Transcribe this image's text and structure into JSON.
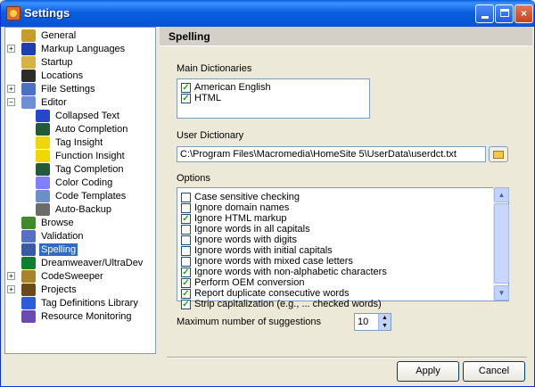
{
  "window": {
    "title": "Settings"
  },
  "tree": {
    "items": [
      {
        "label": "General",
        "icon": "gear-icon",
        "color": "#c79b2c"
      },
      {
        "label": "Markup Languages",
        "icon": "code-brackets-icon",
        "color": "#1d3fb4",
        "expander": "+"
      },
      {
        "label": "Startup",
        "icon": "folder-icon",
        "color": "#d6b34a"
      },
      {
        "label": "Locations",
        "icon": "save-icon",
        "color": "#2c2c2c"
      },
      {
        "label": "File Settings",
        "icon": "file-settings-icon",
        "color": "#4a72c0",
        "expander": "+"
      },
      {
        "label": "Editor",
        "icon": "editor-icon",
        "color": "#6b90d8",
        "expander": "−"
      },
      {
        "label": "Collapsed Text",
        "icon": "collapsed-text-icon",
        "color": "#2448c8"
      },
      {
        "label": "Auto Completion",
        "icon": "glasses-icon",
        "color": "#255a39"
      },
      {
        "label": "Tag Insight",
        "icon": "lightbulb-icon",
        "color": "#f2d600"
      },
      {
        "label": "Function Insight",
        "icon": "lightbulb-icon",
        "color": "#f2d600"
      },
      {
        "label": "Tag Completion",
        "icon": "glasses-icon",
        "color": "#255a39"
      },
      {
        "label": "Color Coding",
        "icon": "color-coding-icon",
        "color": "#8080ff"
      },
      {
        "label": "Code Templates",
        "icon": "templates-icon",
        "color": "#6c8fcc"
      },
      {
        "label": "Auto-Backup",
        "icon": "backup-icon",
        "color": "#6b6b6b"
      },
      {
        "label": "Browse",
        "icon": "globe-icon",
        "color": "#3f8a2b"
      },
      {
        "label": "Validation",
        "icon": "validation-icon",
        "color": "#5670c6"
      },
      {
        "label": "Spelling",
        "icon": "spelling-icon",
        "color": "#385c9f"
      },
      {
        "label": "Dreamweaver/UltraDev",
        "icon": "dreamweaver-icon",
        "color": "#0d7f31"
      },
      {
        "label": "CodeSweeper",
        "icon": "broom-icon",
        "color": "#a9822c",
        "expander": "+"
      },
      {
        "label": "Projects",
        "icon": "projects-icon",
        "color": "#6a4a18",
        "expander": "+"
      },
      {
        "label": "Tag Definitions Library",
        "icon": "tag-library-icon",
        "color": "#2c5dd9"
      },
      {
        "label": "Resource Monitoring",
        "icon": "monitor-icon",
        "color": "#6b4ab4"
      }
    ]
  },
  "panel": {
    "title": "Spelling",
    "main_dictionaries": {
      "label": "Main Dictionaries",
      "items": [
        {
          "label": "American English",
          "checked": true
        },
        {
          "label": "HTML",
          "checked": true
        }
      ]
    },
    "user_dictionary": {
      "label": "User Dictionary",
      "value": "C:\\Program Files\\Macromedia\\HomeSite 5\\UserData\\userdct.txt"
    },
    "options": {
      "label": "Options",
      "items": [
        {
          "label": "Case sensitive checking",
          "checked": false
        },
        {
          "label": "Ignore domain names",
          "checked": false
        },
        {
          "label": "Ignore HTML markup",
          "checked": true
        },
        {
          "label": "Ignore words in all capitals",
          "checked": false
        },
        {
          "label": "Ignore words with digits",
          "checked": false
        },
        {
          "label": "Ignore words with initial capitals",
          "checked": false
        },
        {
          "label": "Ignore words with mixed case letters",
          "checked": false
        },
        {
          "label": "Ignore words with non-alphabetic characters",
          "checked": true
        },
        {
          "label": "Perform OEM conversion",
          "checked": true
        },
        {
          "label": "Report duplicate consecutive words",
          "checked": true
        },
        {
          "label": "Strip capitalization (e.g., ... checked words)",
          "checked": true
        }
      ]
    },
    "max_suggestions": {
      "label": "Maximum number of suggestions",
      "value": "10"
    }
  },
  "buttons": {
    "apply": "Apply",
    "cancel": "Cancel"
  }
}
